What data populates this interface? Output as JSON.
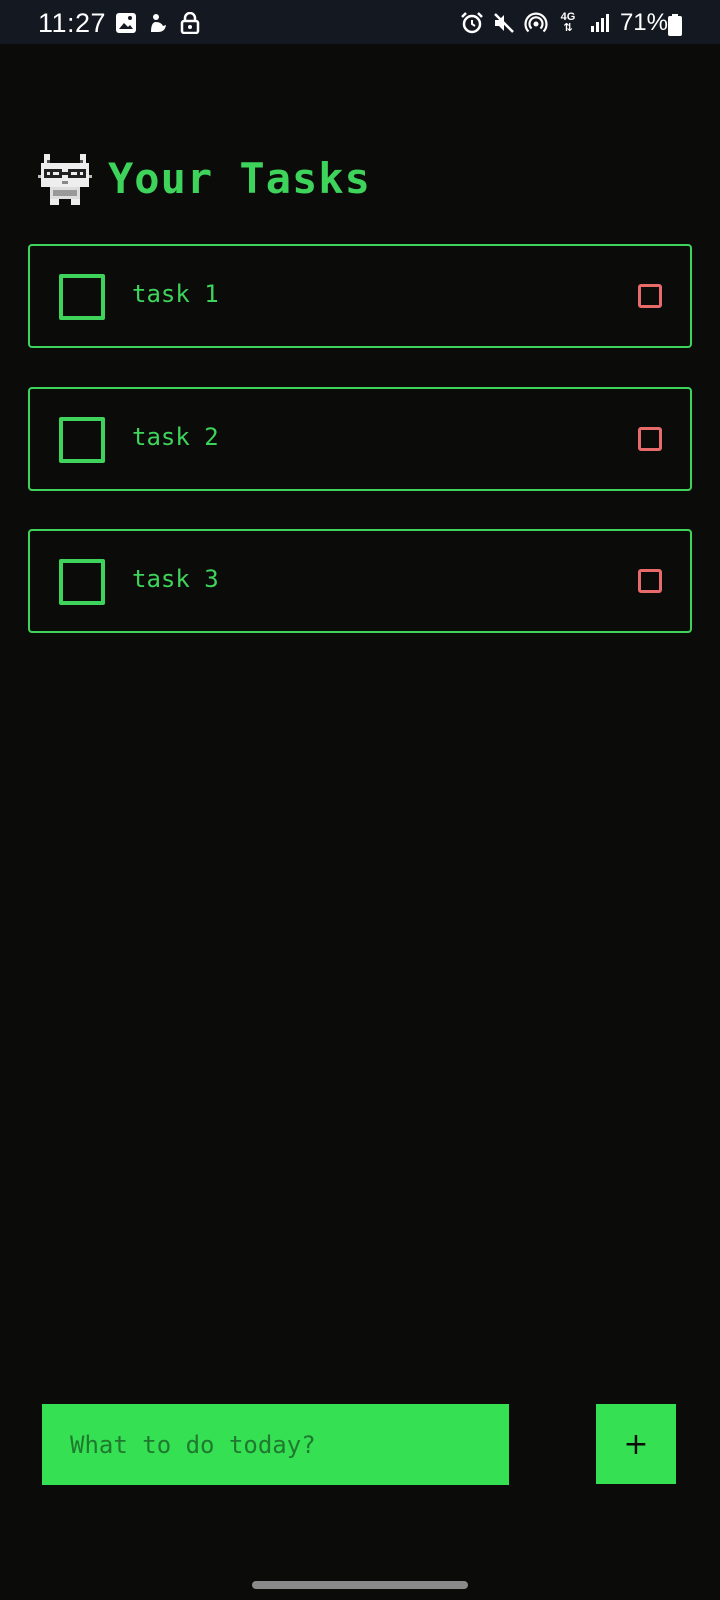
{
  "status_bar": {
    "time": "11:27",
    "battery": "71%",
    "network": "4G",
    "left_icons": [
      "gallery-icon",
      "notification-icon",
      "lock-icon"
    ],
    "right_icons": [
      "alarm-icon",
      "mute-icon",
      "hotspot-icon",
      "network-4g-icon",
      "signal-icon",
      "battery-icon"
    ]
  },
  "header": {
    "title": "Your Tasks",
    "logo_icon": "pixel-cat-icon"
  },
  "tasks": [
    {
      "label": "task 1",
      "checked": false
    },
    {
      "label": "task 2",
      "checked": false
    },
    {
      "label": "task 3",
      "checked": false
    }
  ],
  "composer": {
    "placeholder": "What to do today?",
    "add_label": "+"
  },
  "colors": {
    "accent": "#3ed35a",
    "input_bg": "#35e052",
    "delete": "#e86b6b",
    "background": "#0b0c0a"
  }
}
